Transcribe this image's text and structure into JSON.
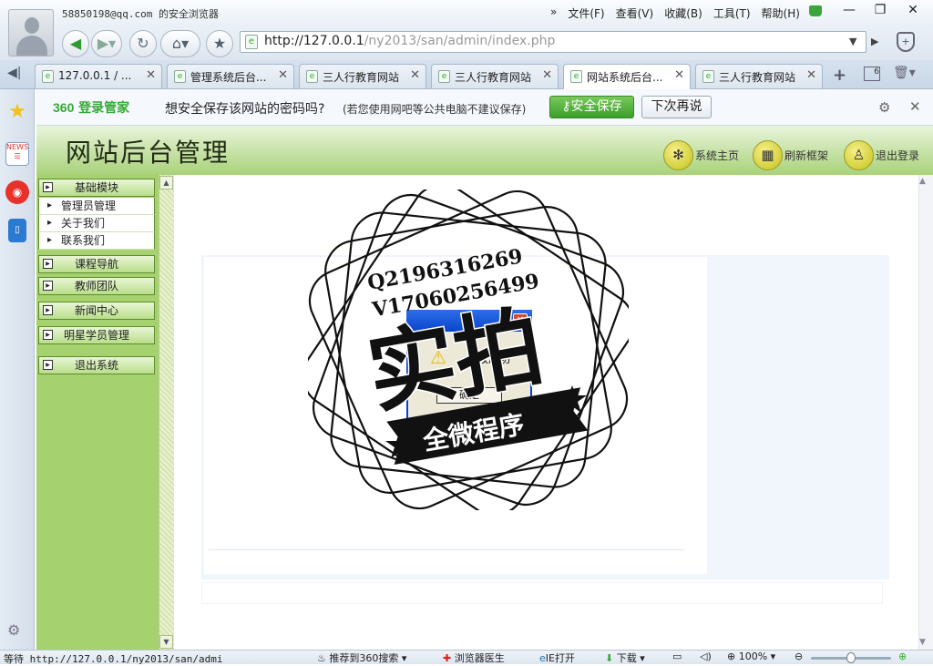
{
  "titlebar": {
    "user": "58850198@qq.com",
    "app_name": "的安全浏览器",
    "menu": [
      "文件(F)",
      "查看(V)",
      "收藏(B)",
      "工具(T)",
      "帮助(H)"
    ],
    "minimize": "—",
    "restore": "❐",
    "close": "✕"
  },
  "address": {
    "prefix": "http://127.0.0.1",
    "path": "/ny2013/san/admin/index.php"
  },
  "tabs": [
    {
      "label": "127.0.0.1 / ..."
    },
    {
      "label": "管理系统后台..."
    },
    {
      "label": "三人行教育网站"
    },
    {
      "label": "三人行教育网站"
    },
    {
      "label": "网站系统后台..."
    },
    {
      "label": "三人行教育网站"
    }
  ],
  "tab_count": "6",
  "password_bar": {
    "logo_number": "360",
    "logo_text": "登录管家",
    "question": "想安全保存该网站的密码吗?",
    "note": "(若您使用网吧等公共电脑不建议保存)",
    "save_label": "安全保存",
    "later_label": "下次再说"
  },
  "admin": {
    "title": "网站后台管理",
    "home_label": "系统主页",
    "refresh_label": "刷新框架",
    "logout_label": "退出登录"
  },
  "menu": {
    "basic": "基础模块",
    "basic_items": [
      "管理员管理",
      "关于我们",
      "联系我们"
    ],
    "courses": "课程导航",
    "teachers": "教师团队",
    "news": "新闻中心",
    "stars": "明星学员管理",
    "exit": "退出系统"
  },
  "dialog": {
    "message": "修改成功",
    "ok_label": "确定"
  },
  "watermark": {
    "line1": "Q2196316269",
    "line2": "V17060256499",
    "big": "实拍",
    "banner": "全微程序"
  },
  "statusbar": {
    "text": "等待 http://127.0.0.1/ny2013/san/admi",
    "recommend": "推荐到360搜索",
    "doctor": "浏览器医生",
    "ie_open": "IE打开",
    "download": "下载",
    "zoom": "100%"
  },
  "colors": {
    "admin_green": "#a5d26f",
    "dialog_blue": "#0a3fd8",
    "save_green": "#4aa832"
  }
}
